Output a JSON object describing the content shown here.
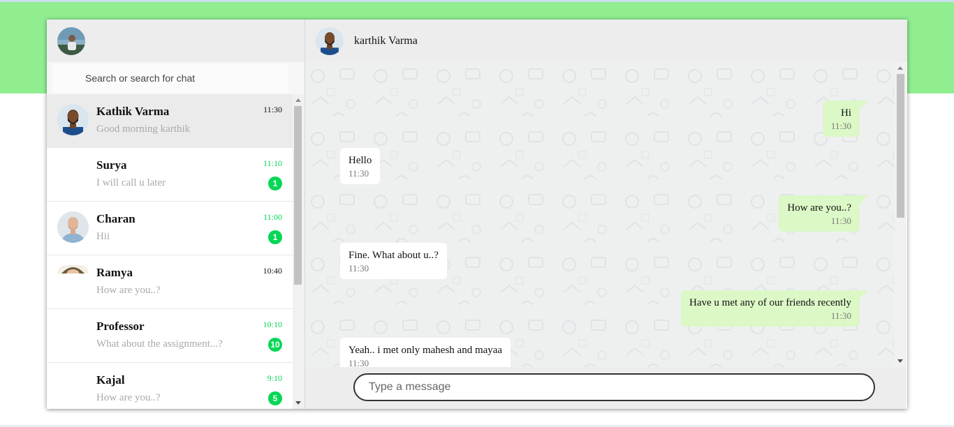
{
  "self": {
    "avatar_icon": "user-avatar-photo"
  },
  "search": {
    "placeholder": "Search or search for chat"
  },
  "chats": [
    {
      "name": "Kathik Varma",
      "preview": "Good morning karthik",
      "time": "11:30",
      "unread": "",
      "avatar": "photo-man-beard",
      "active": true
    },
    {
      "name": "Surya",
      "preview": "I will call u later",
      "time": "11:10",
      "unread": "1",
      "avatar": "",
      "active": false
    },
    {
      "name": "Charan",
      "preview": "Hii",
      "time": "11:00",
      "unread": "1",
      "avatar": "photo-man-blue-shirt",
      "active": false
    },
    {
      "name": "Ramya",
      "preview": "How are you..?",
      "time": "10:40",
      "unread": "",
      "avatar": "photo-woman-partial",
      "active": false
    },
    {
      "name": "Professor",
      "preview": "What about the assignment...?",
      "time": "10:10",
      "unread": "10",
      "avatar": "",
      "active": false
    },
    {
      "name": "Kajal",
      "preview": "How are you..?",
      "time": "9:10",
      "unread": "5",
      "avatar": "",
      "active": false
    }
  ],
  "conversation": {
    "contact_name": "karthik Varma",
    "messages": [
      {
        "direction": "out",
        "text": "Hi",
        "time": "11:30"
      },
      {
        "direction": "in",
        "text": "Hello",
        "time": "11:30"
      },
      {
        "direction": "out",
        "text": "How are you..?",
        "time": "11:30"
      },
      {
        "direction": "in",
        "text": "Fine. What about u..?",
        "time": "11:30"
      },
      {
        "direction": "out",
        "text": "Have u met any of our friends recently",
        "time": "11:30"
      },
      {
        "direction": "in",
        "text": "Yeah.. i met only mahesh and mayaa",
        "time": "11:30"
      }
    ]
  },
  "composer": {
    "placeholder": "Type a message"
  },
  "colors": {
    "accent_band": "#90ee90",
    "unread_green": "#06d755",
    "outgoing_bubble": "#dcf8c6",
    "panel_gray": "#ededed"
  }
}
